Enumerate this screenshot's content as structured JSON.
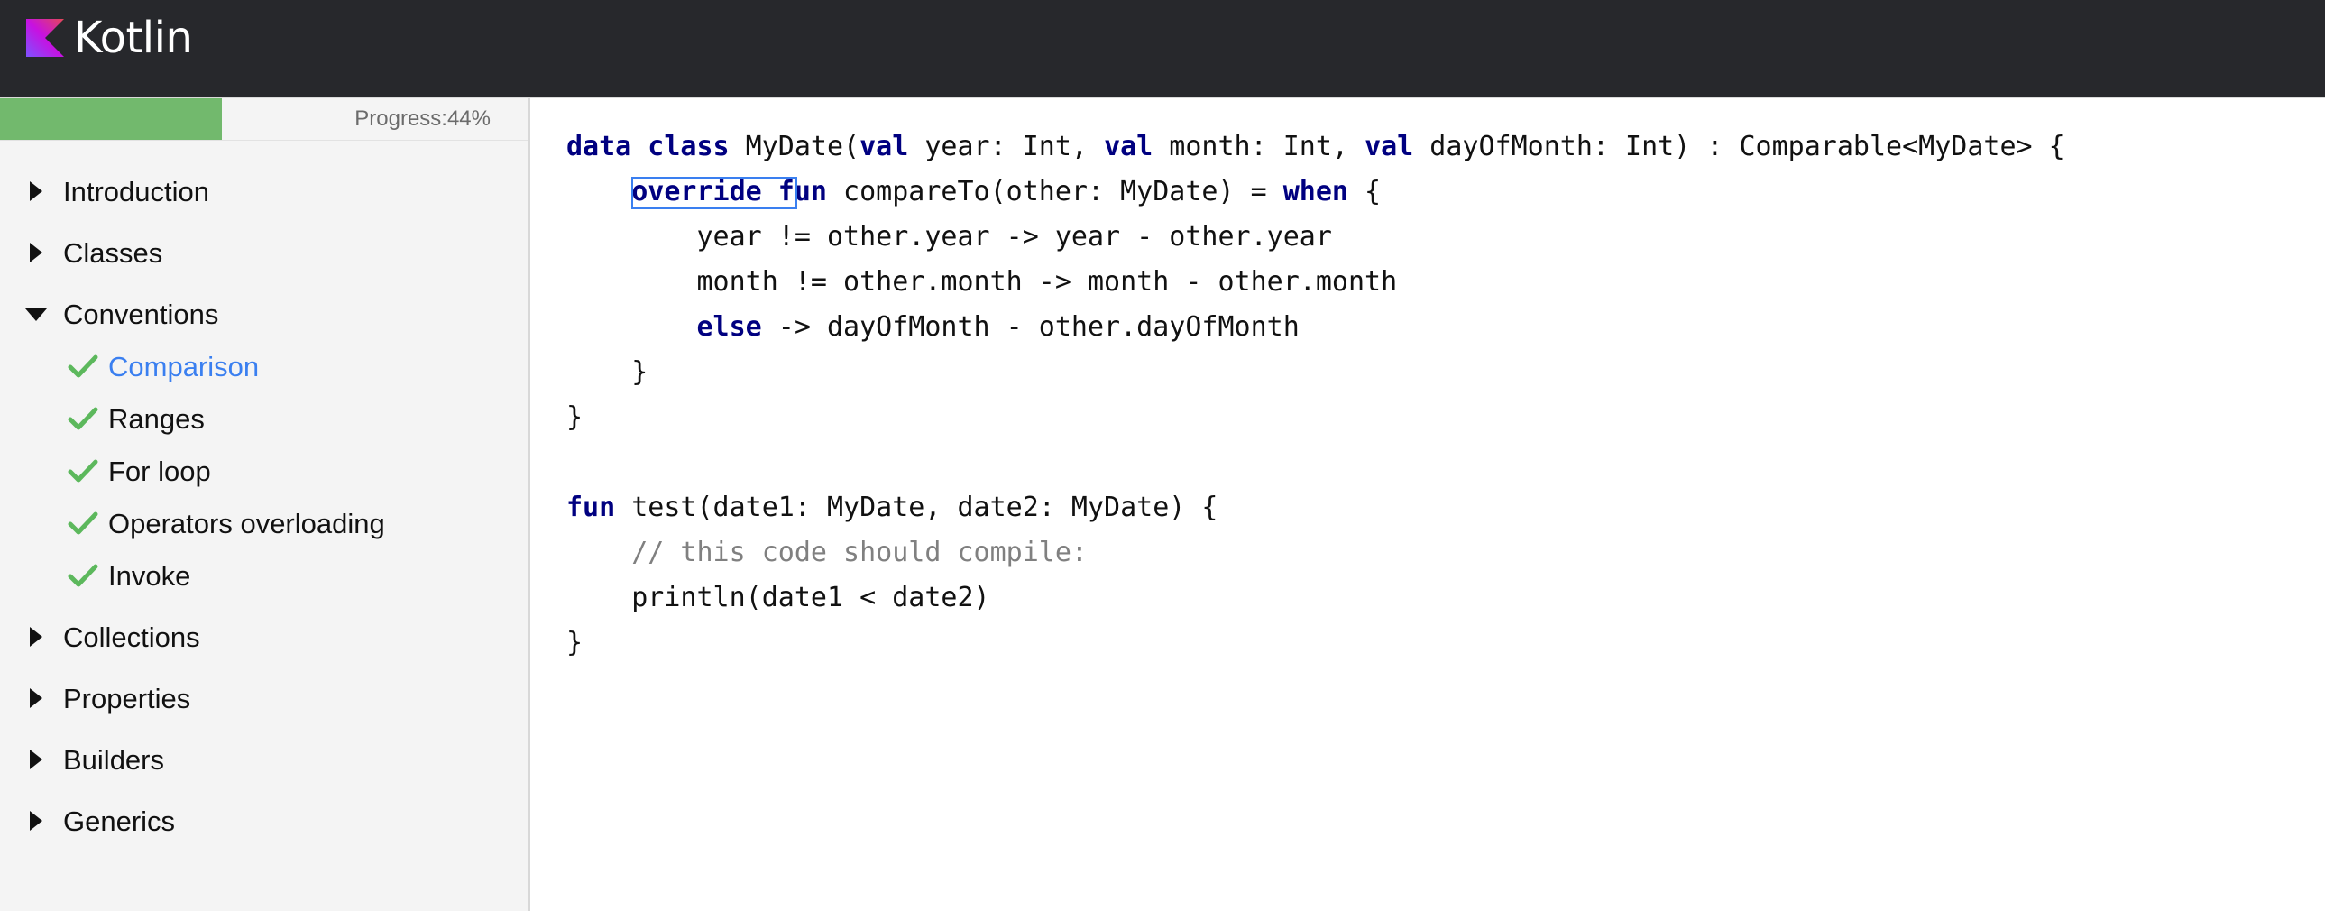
{
  "header": {
    "logo_icon": "kotlin-logo-icon",
    "logo_text": "Kotlin",
    "background": "#27282c"
  },
  "progress": {
    "label": "Progress:",
    "percent_text": "44%",
    "value": 0.44,
    "fill_color": "#72b96d"
  },
  "sidebar": {
    "sections": [
      {
        "label": "Introduction",
        "expanded": false
      },
      {
        "label": "Classes",
        "expanded": false
      },
      {
        "label": "Conventions",
        "expanded": true,
        "items": [
          {
            "label": "Comparison",
            "completed": true,
            "active": true
          },
          {
            "label": "Ranges",
            "completed": true,
            "active": false
          },
          {
            "label": "For loop",
            "completed": true,
            "active": false
          },
          {
            "label": "Operators overloading",
            "completed": true,
            "active": false
          },
          {
            "label": "Invoke",
            "completed": true,
            "active": false
          }
        ]
      },
      {
        "label": "Collections",
        "expanded": false
      },
      {
        "label": "Properties",
        "expanded": false
      },
      {
        "label": "Builders",
        "expanded": false
      },
      {
        "label": "Generics",
        "expanded": false
      }
    ],
    "active_color": "#3a7ff0",
    "check_color": "#5cb85c"
  },
  "editor": {
    "lines": [
      [
        {
          "t": "data class",
          "k": "kw"
        },
        {
          "t": " MyDate("
        },
        {
          "t": "val",
          "k": "kw"
        },
        {
          "t": " year: Int, "
        },
        {
          "t": "val",
          "k": "kw"
        },
        {
          "t": " month: Int, "
        },
        {
          "t": "val",
          "k": "kw"
        },
        {
          "t": " dayOfMonth: Int) : Comparable<MyDate> {"
        }
      ],
      [
        {
          "t": "    "
        },
        {
          "t": "override fun",
          "k": "kw"
        },
        {
          "t": " compareTo(other: MyDate) = "
        },
        {
          "t": "when",
          "k": "kw"
        },
        {
          "t": " {"
        }
      ],
      [
        {
          "t": "        year != other.year -> year - other.year"
        }
      ],
      [
        {
          "t": "        month != other.month -> month - other.month"
        }
      ],
      [
        {
          "t": "        "
        },
        {
          "t": "else",
          "k": "kw"
        },
        {
          "t": " -> dayOfMonth - other.dayOfMonth"
        }
      ],
      [
        {
          "t": "    }"
        }
      ],
      [
        {
          "t": "}"
        }
      ],
      [],
      [
        {
          "t": "fun",
          "k": "kw"
        },
        {
          "t": " test(date1: MyDate, date2: MyDate) {"
        }
      ],
      [
        {
          "t": "    "
        },
        {
          "t": "// this code should compile:",
          "k": "cm"
        }
      ],
      [
        {
          "t": "    println(date1 < date2)"
        }
      ],
      [
        {
          "t": "}"
        }
      ]
    ]
  }
}
